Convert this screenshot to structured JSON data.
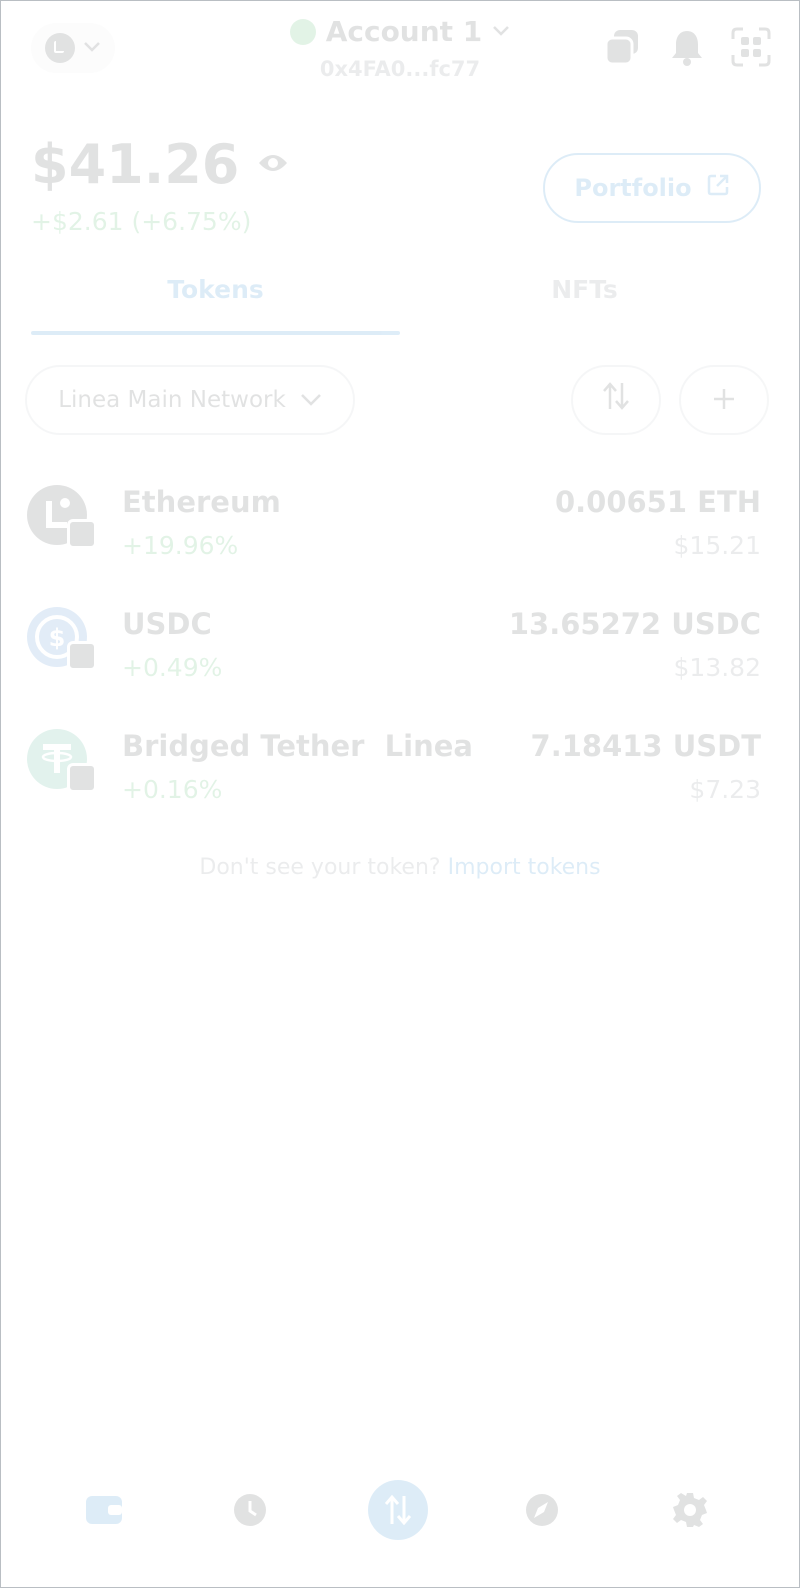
{
  "header": {
    "account_name": "Account 1",
    "account_address": "0x4FA0...fc77",
    "icons": [
      "network-avatar-icon",
      "chevron-down-icon",
      "copy-icon",
      "bell-icon",
      "scan-icon"
    ]
  },
  "balance": {
    "amount": "$41.26",
    "change": "+$2.61 (+6.75%)",
    "portfolio_label": "Portfolio"
  },
  "tabs": [
    {
      "label": "Tokens",
      "active": true
    },
    {
      "label": "NFTs",
      "active": false
    }
  ],
  "filter": {
    "network_label": "Linea Main Network"
  },
  "tokens": [
    {
      "name": "Ethereum",
      "change": "+19.96%",
      "amount": "0.00651 ETH",
      "value": "$15.21",
      "icon": "ethereum-icon"
    },
    {
      "name": "USDC",
      "change": "+0.49%",
      "amount": "13.65272 USDC",
      "value": "$13.82",
      "icon": "usdc-icon"
    },
    {
      "name": "Bridged Tether  Linea",
      "change": "+0.16%",
      "amount": "7.18413 USDT",
      "value": "$7.23",
      "icon": "tether-icon"
    }
  ],
  "import": {
    "prompt": "Don't see your token?",
    "link": "Import tokens"
  },
  "bottom_nav": [
    "wallet-icon",
    "clock-icon",
    "swap-icon",
    "explore-icon",
    "settings-icon"
  ],
  "colors": {
    "accent": "#0376c9",
    "positive": "#28a745",
    "text": "#24272a",
    "muted": "#6a737d"
  }
}
